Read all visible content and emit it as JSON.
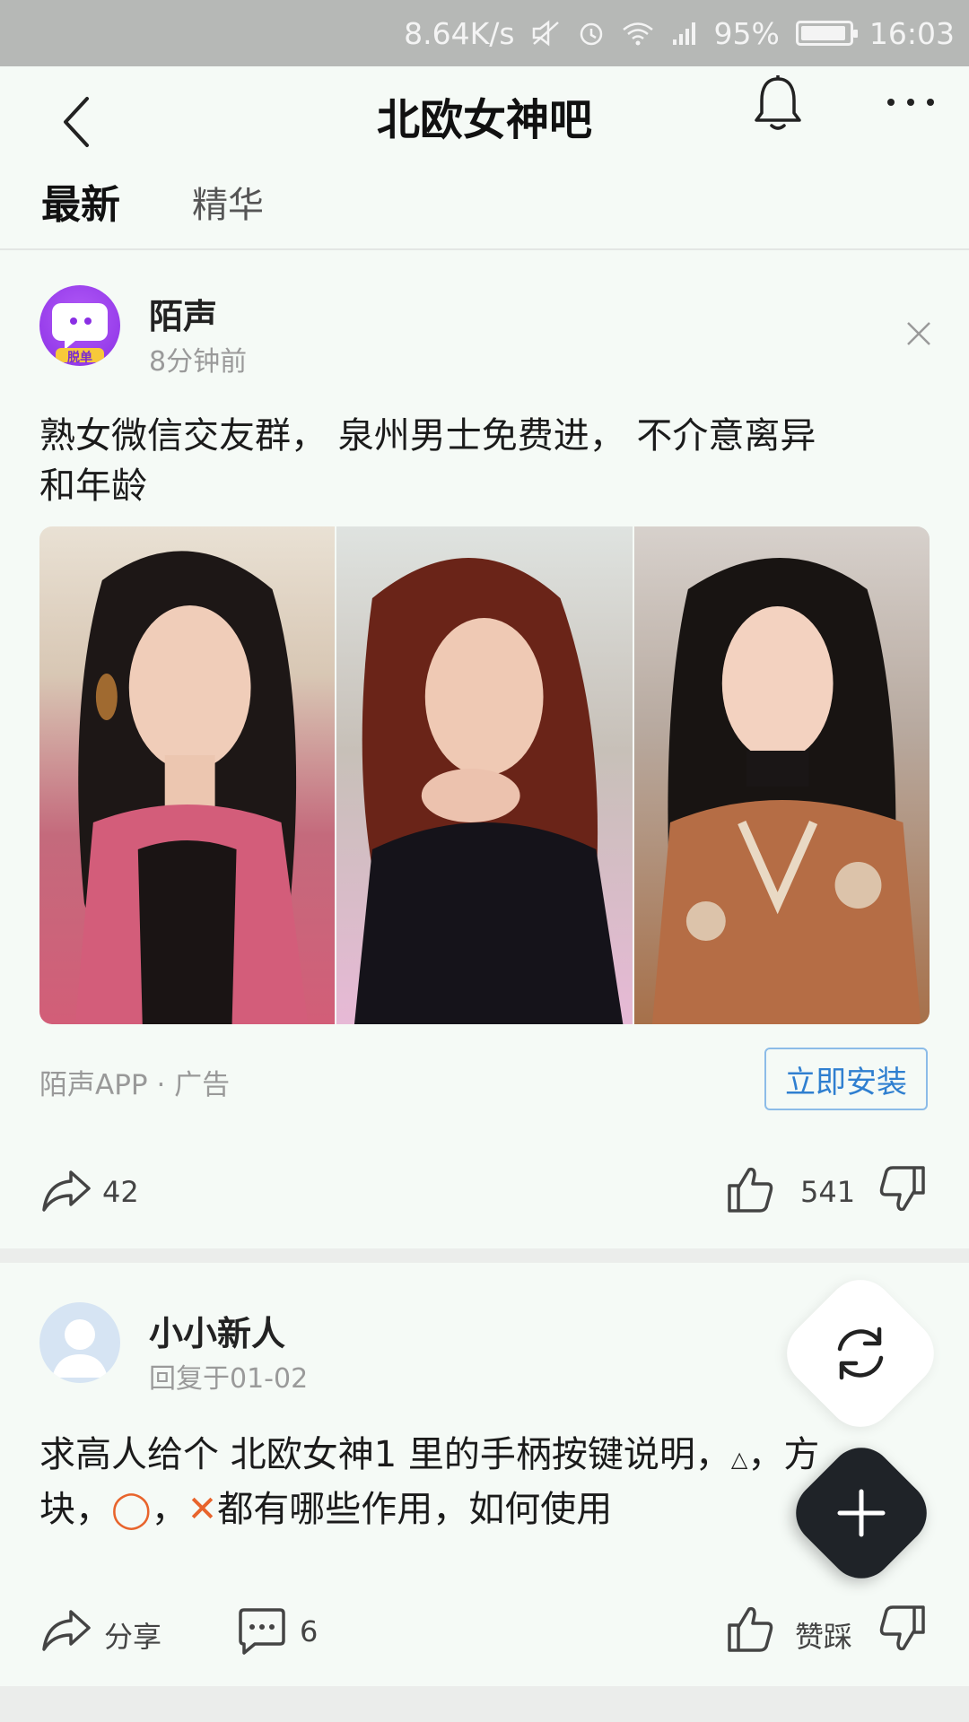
{
  "status_bar": {
    "network_speed": "8.64K/s",
    "battery": "95%",
    "time": "16:03"
  },
  "header": {
    "title": "北欧女神吧"
  },
  "tabs": [
    {
      "label": "最新"
    },
    {
      "label": "精华"
    }
  ],
  "ad_post": {
    "username": "陌声",
    "time": "8分钟前",
    "avatar_badge": "脱单",
    "text_line1": "熟女微信交友群，  泉州男士免费进，  不介意离异",
    "text_line2": "和年龄",
    "source": "陌声APP · 广告",
    "install_label": "立即安装",
    "share_count": "42",
    "like_count": "541",
    "accent_color": "#9a3ef0"
  },
  "post2": {
    "username": "小小新人",
    "time": "回复于01-02",
    "text_part1": "求高人给个 北欧女神1 里的手柄按键说明，",
    "tri_glyph": "△",
    "text_part2": "，方",
    "text_part3": "块，",
    "circle_glyph": "◯",
    "comma": "，",
    "cross_glyph": "✕",
    "text_part4": "都有哪些作用，如何使用",
    "share_label": "分享",
    "comment_count": "6",
    "vote_label": "赞踩"
  }
}
